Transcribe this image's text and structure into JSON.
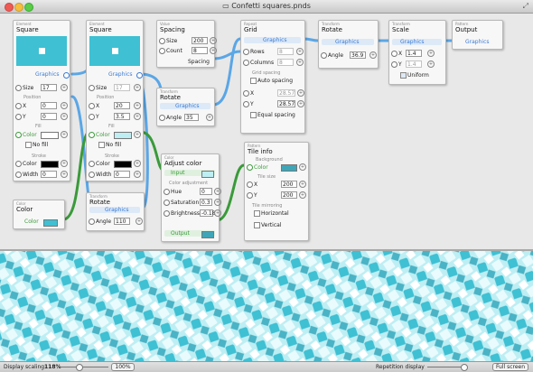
{
  "window": {
    "title": "Confetti squares.pnds"
  },
  "nodes": {
    "square1": {
      "kind": "Element",
      "title": "Square",
      "out": "Graphics",
      "size_label": "Size",
      "size": "17",
      "position": "Position",
      "x_label": "X",
      "x": "0",
      "y_label": "Y",
      "y": "0",
      "fill": "Fill",
      "color_label": "Color",
      "no_fill": "No fill",
      "stroke": "Stroke",
      "stroke_color_label": "Color",
      "width_label": "Width",
      "width": "0"
    },
    "square2": {
      "kind": "Element",
      "title": "Square",
      "out": "Graphics",
      "size_label": "Size",
      "size": "17",
      "position": "Position",
      "x_label": "X",
      "x": "20",
      "y_label": "Y",
      "y": "3.5",
      "fill": "Fill",
      "color_label": "Color",
      "no_fill": "No fill",
      "stroke": "Stroke",
      "stroke_color_label": "Color",
      "width_label": "Width",
      "width": "0"
    },
    "spacing": {
      "kind": "Value",
      "title": "Spacing",
      "size_label": "Size",
      "size": "200",
      "count_label": "Count",
      "count": "8",
      "out": "Spacing"
    },
    "rotate1": {
      "kind": "Transform",
      "title": "Rotate",
      "in": "Graphics",
      "angle_label": "Angle",
      "angle": "35"
    },
    "grid": {
      "kind": "Repeat",
      "title": "Grid",
      "in": "Graphics",
      "rows_label": "Rows",
      "rows": "8",
      "columns_label": "Columns",
      "columns": "8",
      "grid_spacing": "Grid spacing",
      "auto_spacing": "Auto spacing",
      "x_label": "X",
      "x": "28.57",
      "y_label": "Y",
      "y": "28.57",
      "equal_spacing": "Equal spacing"
    },
    "rotate2": {
      "kind": "Transform",
      "title": "Rotate",
      "in": "Graphics",
      "angle_label": "Angle",
      "angle": "36.9"
    },
    "scale": {
      "kind": "Transform",
      "title": "Scale",
      "in": "Graphics",
      "x_label": "X",
      "x": "1.4",
      "y_label": "Y",
      "y": "1.4",
      "uniform": "Uniform"
    },
    "output": {
      "kind": "Pattern",
      "title": "Output",
      "in": "Graphics"
    },
    "color": {
      "kind": "Color",
      "title": "Color",
      "out": "Color"
    },
    "rotate3": {
      "kind": "Transform",
      "title": "Rotate",
      "in": "Graphics",
      "angle_label": "Angle",
      "angle": "110"
    },
    "adjust": {
      "kind": "Color",
      "title": "Adjust color",
      "in": "Input",
      "section": "Color adjustment",
      "hue_label": "Hue",
      "hue": "0",
      "sat_label": "Saturation",
      "sat": "0.3",
      "bri_label": "Brightness",
      "bri": "-0.18",
      "out": "Output"
    },
    "tile": {
      "kind": "Pattern",
      "title": "Tile info",
      "bg": "Background",
      "color_label": "Color",
      "tile_size": "Tile size",
      "x_label": "X",
      "x": "200",
      "y_label": "Y",
      "y": "200",
      "mirroring": "Tile mirroring",
      "horizontal": "Horizontal",
      "vertical": "Vertical"
    }
  },
  "status": {
    "scaling_label": "Display scaling",
    "scaling_value": "118%",
    "reset": "100%",
    "repetition": "Repetition display",
    "fullscreen": "Full screen"
  },
  "colors": {
    "accent": "#3a7bd5",
    "preview": "#3fc0d3",
    "pattern_bg": "#bdeef3",
    "wire_blue": "#5aa6e6",
    "wire_green": "#3a9a3a"
  }
}
